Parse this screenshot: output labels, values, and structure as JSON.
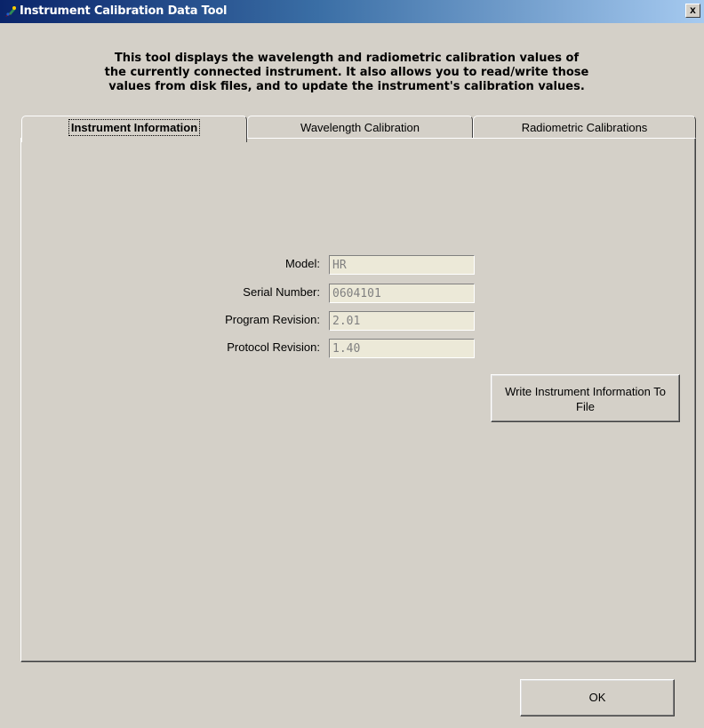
{
  "window": {
    "title": "Instrument Calibration Data Tool",
    "close_label": "x"
  },
  "description": "This tool displays the wavelength and radiometric calibration values of\nthe currently connected instrument. It also allows you to read/write those\nvalues from disk files, and to update the instrument's calibration values.",
  "tabs": [
    {
      "label": "Instrument Information",
      "active": true
    },
    {
      "label": "Wavelength Calibration",
      "active": false
    },
    {
      "label": "Radiometric Calibrations",
      "active": false
    }
  ],
  "fields": {
    "model": {
      "label": "Model:",
      "value": "HR"
    },
    "serial_number": {
      "label": "Serial Number:",
      "value": "0604101"
    },
    "program_revision": {
      "label": "Program Revision:",
      "value": "2.01"
    },
    "protocol_revision": {
      "label": "Protocol Revision:",
      "value": "1.40"
    }
  },
  "buttons": {
    "write_info": "Write Instrument Information To File",
    "ok": "OK"
  },
  "icons": {
    "app": "paint-palette-icon",
    "close": "close-icon"
  },
  "colors": {
    "titlebar_start": "#0a246a",
    "titlebar_end": "#a6caf0",
    "face": "#d4d0c8",
    "disabled_text": "#808080"
  }
}
